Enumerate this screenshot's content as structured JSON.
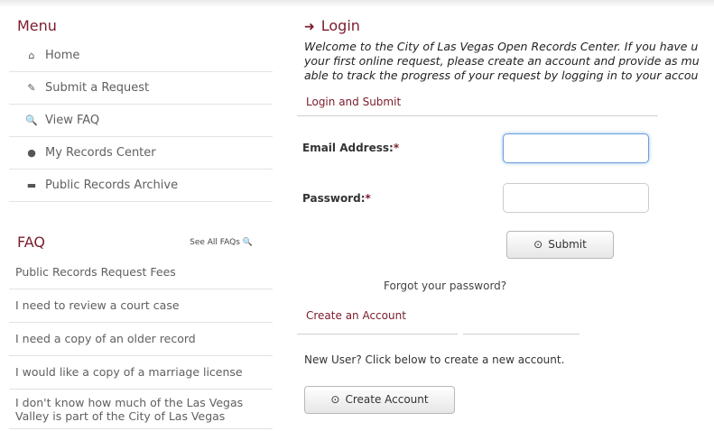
{
  "menu": {
    "title": "Menu",
    "items": [
      {
        "icon": "home-icon",
        "glyph": "⌂",
        "label": "Home"
      },
      {
        "icon": "edit-icon",
        "glyph": "✎",
        "label": "Submit a Request"
      },
      {
        "icon": "search-icon",
        "glyph": "🔍",
        "label": "View FAQ"
      },
      {
        "icon": "user-icon",
        "glyph": "●",
        "label": "My Records Center"
      },
      {
        "icon": "archive-icon",
        "glyph": "▬",
        "label": "Public Records Archive"
      }
    ]
  },
  "faq": {
    "title": "FAQ",
    "see_all": "See All FAQs",
    "items": [
      "Public Records Request Fees",
      "I need to review a court case",
      "I need a copy of an older record",
      "I would like a copy of a marriage license",
      "I don't know how much of the Las Vegas Valley is part of the City of Las Vegas"
    ]
  },
  "login": {
    "title": "Login",
    "welcome_lines": [
      "Welcome to the City of Las Vegas Open Records Center. If you have u",
      "your first online request, please create an account and provide as mu",
      "able to track the progress of your request by logging in to your accou"
    ],
    "subhead": "Login and Submit",
    "email_label": "Email Address:",
    "password_label": "Password:",
    "required_mark": "*",
    "email_value": "",
    "password_value": "",
    "submit_label": "Submit",
    "forgot_label": "Forgot your password?",
    "create_head": "Create an Account",
    "new_user_text": "New User? Click below to create a new account.",
    "create_label": "Create Account"
  },
  "colors": {
    "accent": "#7a1c2c",
    "focus_border": "#6a9fd6"
  }
}
